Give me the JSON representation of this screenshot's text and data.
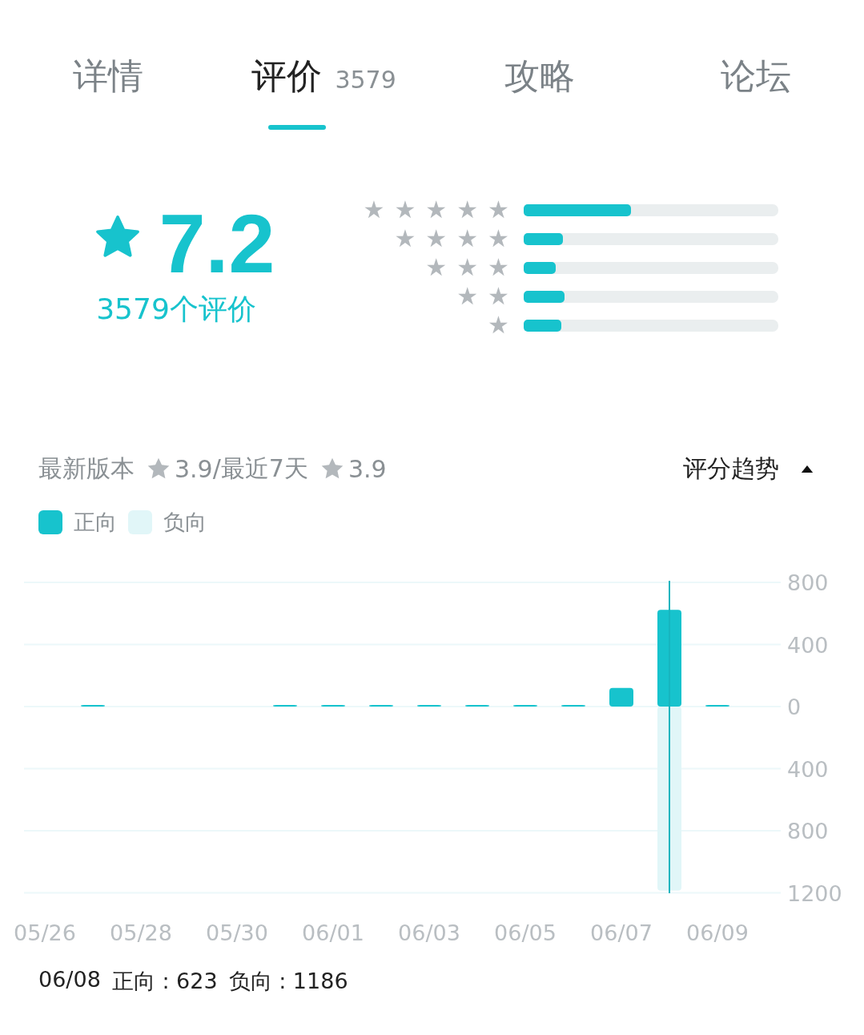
{
  "tabs": [
    {
      "label": "详情",
      "selected": false
    },
    {
      "label": "评价",
      "count": "3579",
      "selected": true
    },
    {
      "label": "攻略",
      "selected": false
    },
    {
      "label": "论坛",
      "selected": false
    }
  ],
  "rating": {
    "score": "7.2",
    "count_label": "3579个评价"
  },
  "distribution": [
    {
      "label": "★★★★★",
      "level": 0.42
    },
    {
      "label": "★★★★",
      "level": 0.155
    },
    {
      "label": "★★★",
      "level": 0.127
    },
    {
      "label": "★★",
      "level": 0.161
    },
    {
      "label": "★",
      "level": 0.148
    }
  ],
  "version_row": {
    "label": "最新版本",
    "version_score": "3.9",
    "recent_label": "/最近7天",
    "recent_score": "3.9",
    "trend_label": "评分趋势",
    "trend_expanded": true
  },
  "chart": {
    "chart_data": {
      "type": "bar",
      "grid": true,
      "categories": [
        "05/26",
        null,
        "05/28",
        null,
        "05/30",
        null,
        "06/01",
        null,
        "06/03",
        null,
        "06/05",
        null,
        "06/07",
        null,
        "06/09"
      ],
      "series": [
        {
          "name": "正向",
          "color": "#17c3cd",
          "values": [
            0,
            3,
            0,
            0,
            0,
            3,
            4,
            4,
            4,
            6,
            5,
            6,
            120,
            623,
            3
          ]
        },
        {
          "name": "负向",
          "color": "#e1f6f8",
          "values": [
            0,
            0,
            0,
            0,
            0,
            0,
            0,
            0,
            0,
            0,
            0,
            0,
            0,
            -1186,
            0
          ]
        }
      ],
      "ylim": [
        -1200,
        800
      ],
      "yticks": [
        {
          "value": 800,
          "label": "800"
        },
        {
          "value": 400,
          "label": "400"
        },
        {
          "value": 0,
          "label": "0"
        },
        {
          "value": -400,
          "label": "400"
        },
        {
          "value": -800,
          "label": "800"
        },
        {
          "value": -1200,
          "label": "1200"
        }
      ]
    }
  },
  "tooltip": {
    "date": "06/08",
    "positive": "正向 : 623",
    "negative": "负向 : 1186"
  }
}
